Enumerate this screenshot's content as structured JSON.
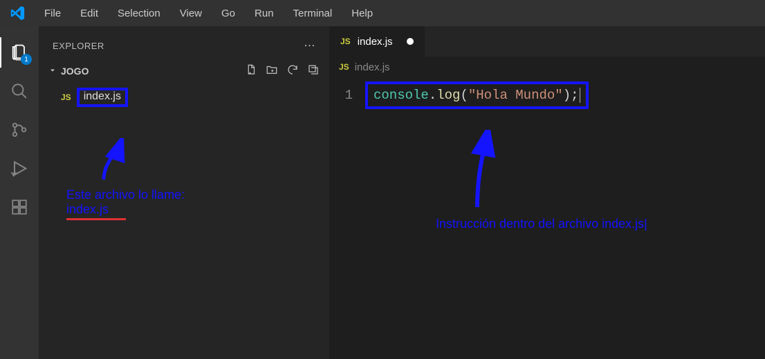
{
  "menu": {
    "items": [
      "File",
      "Edit",
      "Selection",
      "View",
      "Go",
      "Run",
      "Terminal",
      "Help"
    ]
  },
  "activity": {
    "explorer_badge": "1"
  },
  "sidebar": {
    "title": "EXPLORER",
    "folder": "JOGO",
    "file": "index.js"
  },
  "editor": {
    "tab": {
      "name": "index.js"
    },
    "breadcrumb": "index.js",
    "line_number": "1",
    "code": {
      "obj": "console",
      "dot": ".",
      "fn": "log",
      "open": "(",
      "str": "\"Hola Mundo\"",
      "close": ")",
      "semi": ";"
    }
  },
  "annotations": {
    "left_line1": "Este archivo lo llame:",
    "left_line2": "index.js",
    "right": "Instrucción dentro del archivo index.js|"
  }
}
